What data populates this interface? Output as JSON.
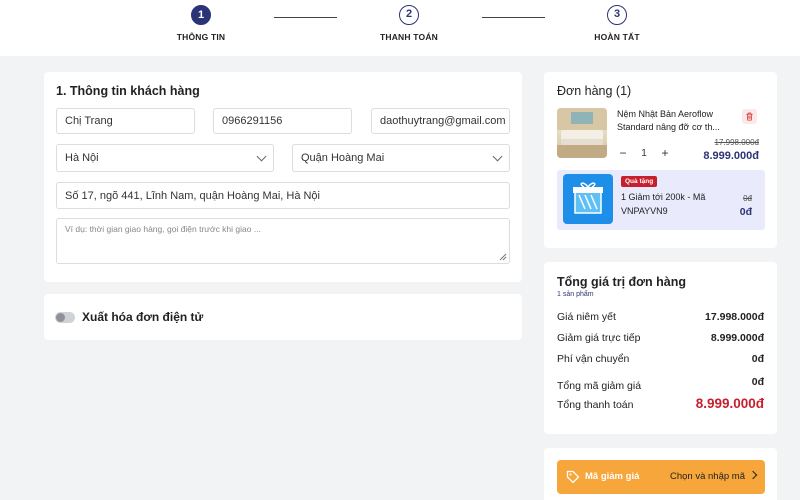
{
  "stepper": {
    "steps": [
      {
        "number": "1",
        "label": "THÔNG TIN"
      },
      {
        "number": "2",
        "label": "THANH TOÁN"
      },
      {
        "number": "3",
        "label": "HOÀN TẤT"
      }
    ]
  },
  "customer": {
    "title": "1. Thông tin khách hàng",
    "name": "Chị Trang",
    "phone": "0966291156",
    "email": "daothuytrang@gmail.com",
    "province": "Hà Nội",
    "district": "Quận Hoàng Mai",
    "address": "Số 17, ngõ 441, Lĩnh Nam, quận Hoàng Mai, Hà Nội",
    "note_placeholder": "Ví dụ: thời gian giao hàng, gọi điện trước khi giao ..."
  },
  "invoice": {
    "label": "Xuất hóa đơn điện tử"
  },
  "order": {
    "title": "Đơn hàng (1)",
    "product": {
      "name_line1": "Nệm Nhật Bản Aeroflow",
      "name_line2": "Standard nâng đỡ cơ th...",
      "quantity": "1",
      "minus": "−",
      "plus": "+",
      "old_price": "17.998.000đ",
      "new_price": "8.999.000đ"
    },
    "gift": {
      "badge": "Quà tặng",
      "name_line1": "1 Giảm tới 200k - Mã",
      "name_line2": "VNPAYVN9",
      "old_price": "0đ",
      "new_price": "0đ"
    }
  },
  "summary": {
    "title": "Tổng giá trị đơn hàng",
    "subtitle": "1 sản phẩm",
    "rows": [
      {
        "label": "Giá niêm yết",
        "value": "17.998.000đ"
      },
      {
        "label": "Giảm giá trực tiếp",
        "value": "8.999.000đ"
      },
      {
        "label": "Phí vận chuyển",
        "value": "0đ"
      },
      {
        "label": "Tổng mã giảm giá",
        "value": "0đ"
      }
    ],
    "total_label": "Tổng thanh toán",
    "total_value": "8.999.000đ"
  },
  "coupon": {
    "label": "Mã giảm giá",
    "action": "Chọn và nhập mã"
  },
  "colors": {
    "primary": "#2b3476",
    "total_red": "#c81f2d",
    "coupon_orange": "#f6a63a"
  }
}
